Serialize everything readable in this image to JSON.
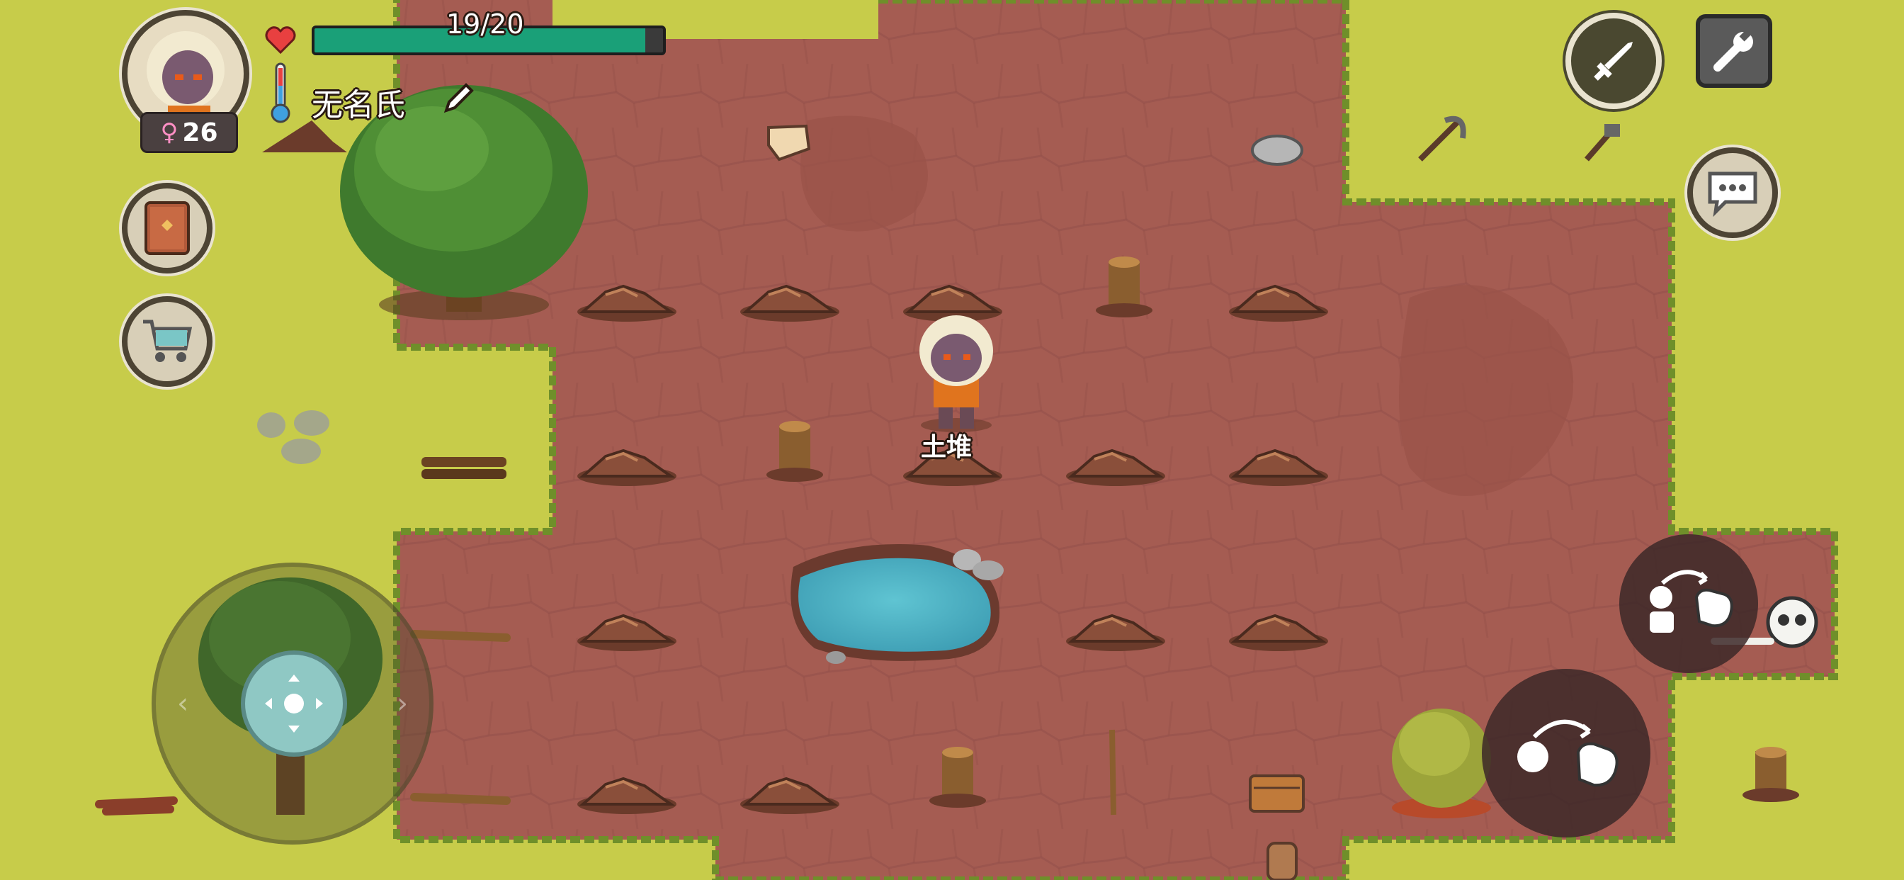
{
  "player": {
    "name": "无名氏",
    "gender_symbol": "♀",
    "age": "26",
    "health_text": "19/20",
    "health_fraction": 0.95,
    "temperature_fraction": 0.45
  },
  "world": {
    "hover_label": "土堆"
  },
  "colors": {
    "grass": "#c7cc4a",
    "dirt": "#a35a52",
    "water": "#56b8c8",
    "health_bar": "#1aa078",
    "health_bg": "#3a3a3a"
  },
  "icons": {
    "heart": "heart-icon",
    "thermometer": "thermometer-icon",
    "edit": "pencil-icon",
    "recipe_book": "book-icon",
    "shop": "shopping-cart-icon",
    "sword": "sword-icon",
    "settings": "wrench-icon",
    "chat": "chat-bubble-icon",
    "joystick": "dpad-icon",
    "pickup_action": "hand-pickup-icon",
    "use_action": "hand-use-icon"
  }
}
